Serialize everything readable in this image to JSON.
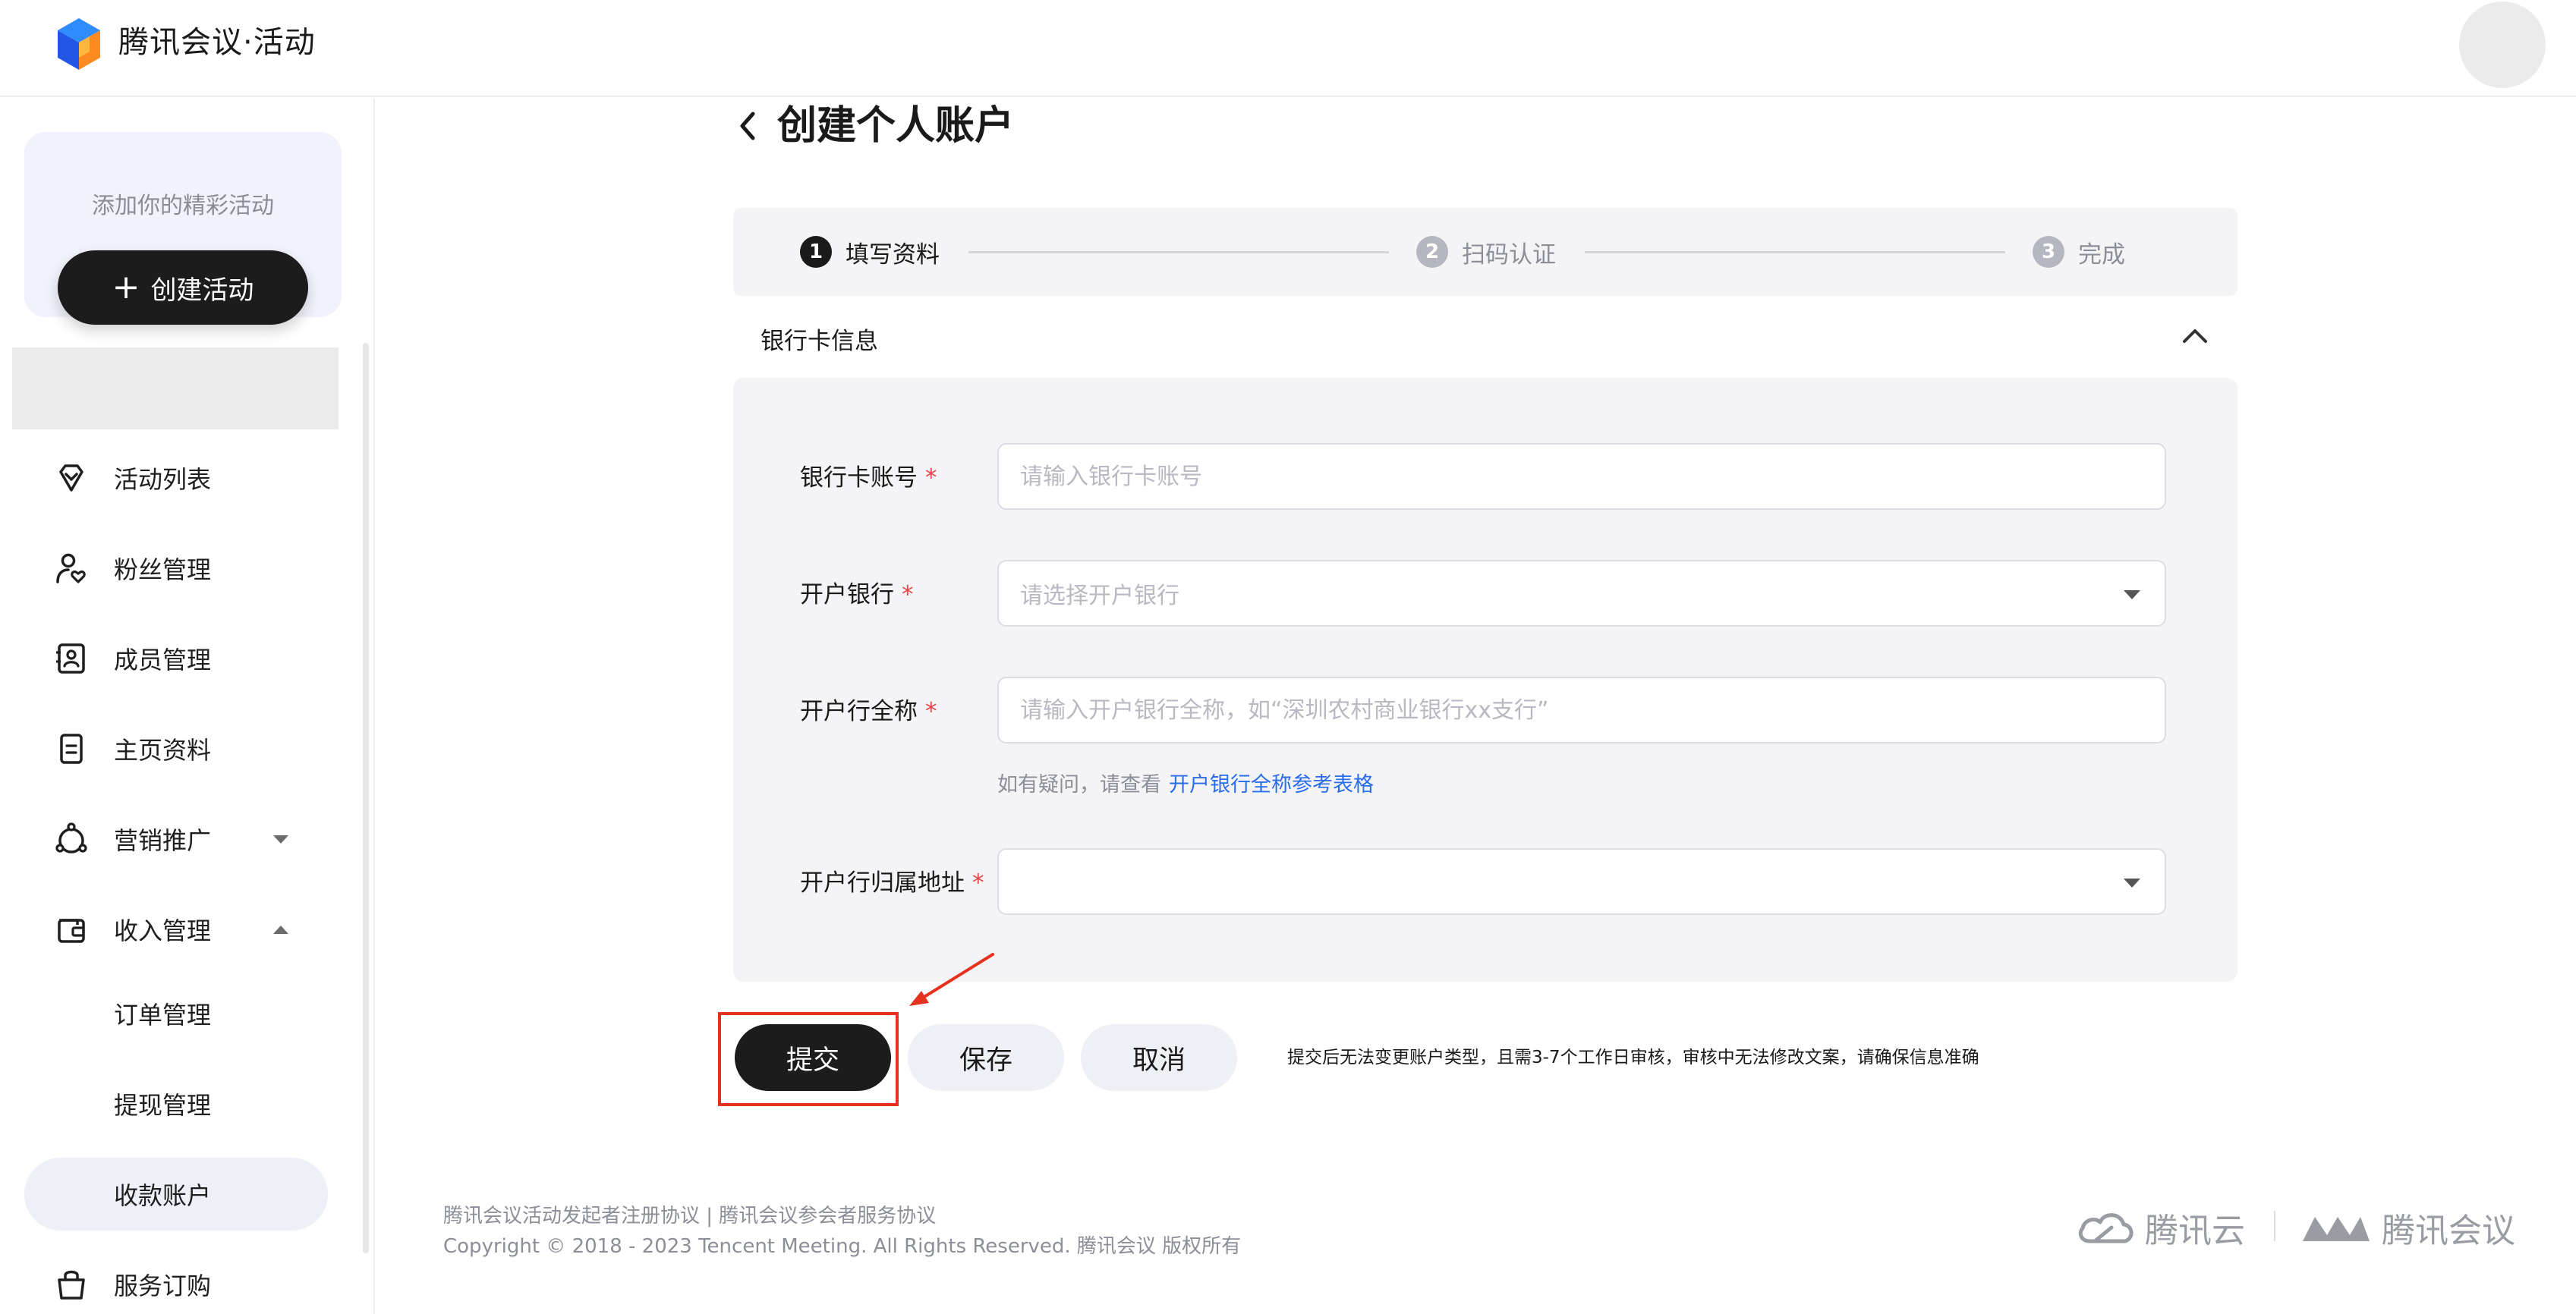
{
  "header": {
    "brand": "腾讯会议·活动"
  },
  "sidebar": {
    "promo_text": "添加你的精彩活动",
    "create_button": "创建活动",
    "items": [
      {
        "label": "活动列表",
        "icon": "diamond-icon"
      },
      {
        "label": "粉丝管理",
        "icon": "user-heart-icon"
      },
      {
        "label": "成员管理",
        "icon": "member-card-icon"
      },
      {
        "label": "主页资料",
        "icon": "document-icon"
      },
      {
        "label": "营销推广",
        "icon": "marketing-icon"
      },
      {
        "label": "收入管理",
        "icon": "wallet-icon"
      }
    ],
    "sub_items": [
      {
        "label": "订单管理"
      },
      {
        "label": "提现管理"
      },
      {
        "label": "收款账户",
        "active": true
      }
    ],
    "last_item": {
      "label": "服务订购",
      "icon": "bag-icon"
    }
  },
  "page": {
    "title": "创建个人账户"
  },
  "steps": [
    {
      "num": "1",
      "label": "填写资料",
      "active": true
    },
    {
      "num": "2",
      "label": "扫码认证",
      "active": false
    },
    {
      "num": "3",
      "label": "完成",
      "active": false
    }
  ],
  "section": {
    "title": "银行卡信息"
  },
  "form": {
    "card_number": {
      "label": "银行卡账号",
      "placeholder": "请输入银行卡账号",
      "value": ""
    },
    "bank": {
      "label": "开户银行",
      "placeholder": "请选择开户银行"
    },
    "branch_name": {
      "label": "开户行全称",
      "placeholder": "请输入开户银行全称，如“深圳农村商业银行xx支行”",
      "value": ""
    },
    "hint_prefix": "如有疑问，请查看",
    "hint_link": "开户银行全称参考表格",
    "branch_address": {
      "label": "开户行归属地址",
      "placeholder": ""
    },
    "required_mark": "*"
  },
  "actions": {
    "submit": "提交",
    "save": "保存",
    "cancel": "取消",
    "notice": "提交后无法变更账户类型，且需3-7个工作日审核，审核中无法修改文案，请确保信息准确"
  },
  "footer": {
    "links": "腾讯会议活动发起者注册协议 | 腾讯会议参会者服务协议",
    "copyright": "Copyright © 2018 - 2023 Tencent Meeting. All Rights Reserved. 腾讯会议 版权所有",
    "logo_cloud": "腾讯云",
    "logo_meeting": "腾讯会议"
  },
  "colors": {
    "primary": "#1c1c1c",
    "link": "#2a6dea",
    "required": "#e54545",
    "annotation": "#e5321e"
  }
}
